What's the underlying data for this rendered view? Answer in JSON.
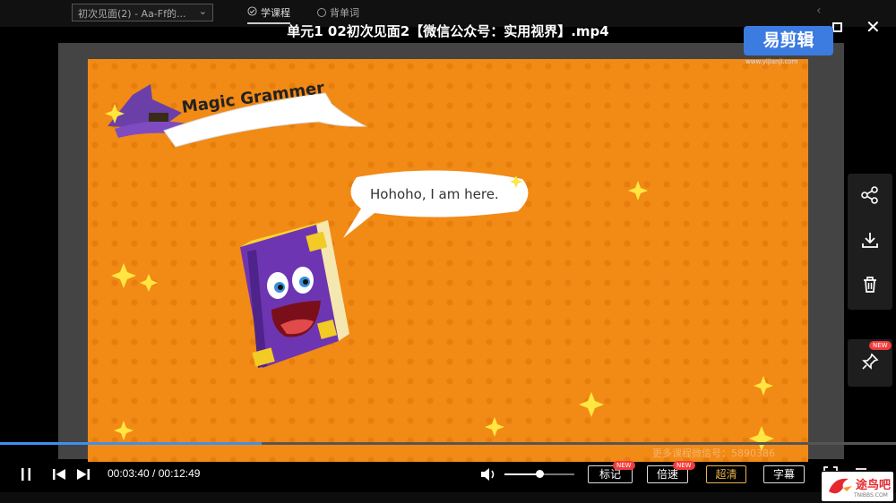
{
  "top": {
    "course_select": "初次见面(2) - Aa-Ff的...",
    "tabs": [
      {
        "label": "学课程",
        "active": true
      },
      {
        "label": "背单词",
        "active": false
      }
    ],
    "video_title": "单元1   02初次见面2【微信公众号：实用视界】.mp4"
  },
  "video": {
    "banner_text": "Magic Grammer",
    "bubble_text": "Hohoho, I am here.",
    "editor_watermark": "易剪辑",
    "editor_watermark_url": "www.yijianji.com",
    "frame_watermark": "更多课程微信号：5890386"
  },
  "side_panel": {
    "icons": [
      "share-icon",
      "download-icon",
      "trash-icon"
    ],
    "pin_badge": "NEW"
  },
  "player": {
    "progress_fraction": 0.2919,
    "volume_fraction": 0.5,
    "current_time": "00:03:40",
    "total_time": "00:12:49",
    "time_separator": " / ",
    "buttons": [
      {
        "label": "标记",
        "badge": "NEW"
      },
      {
        "label": "倍速",
        "badge": "NEW"
      },
      {
        "label": "超清"
      },
      {
        "label": "字幕"
      }
    ]
  },
  "site": {
    "name": "途鸟吧",
    "domain": "TNIBBS.COM"
  },
  "colors": {
    "accent": "#3f8ff0",
    "frame_orange": "#f28a16",
    "badge_red": "#f23b3b",
    "quality_gold": "#e9b44c"
  }
}
